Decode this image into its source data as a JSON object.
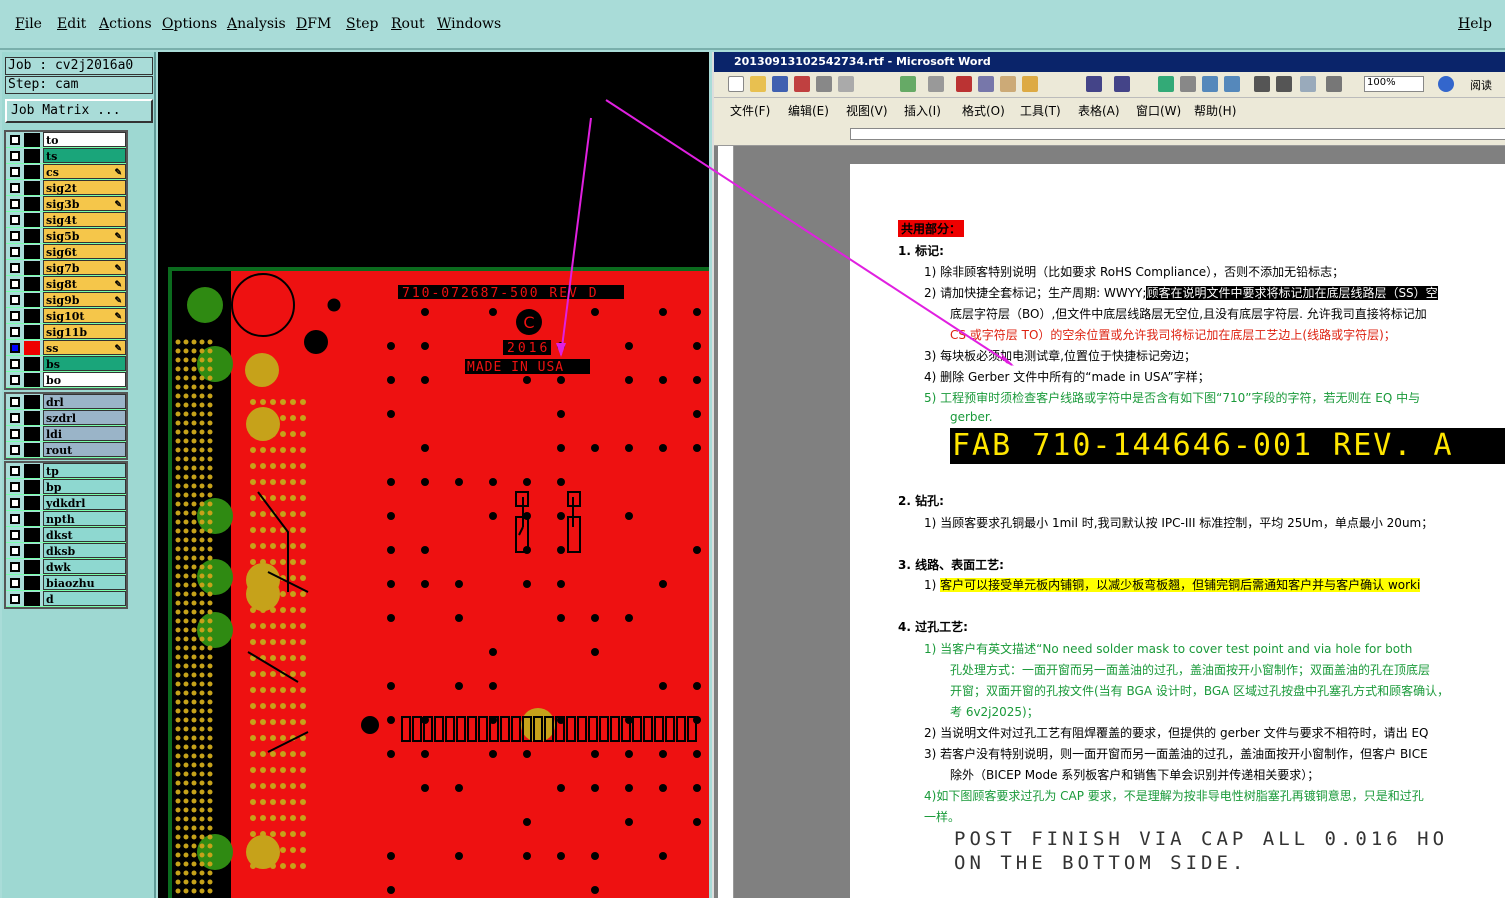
{
  "menu": {
    "file": "File",
    "edit": "Edit",
    "actions": "Actions",
    "options": "Options",
    "analysis": "Analysis",
    "dfm": "DFM",
    "step": "Step",
    "rout": "Rout",
    "windows": "Windows",
    "help": "Help"
  },
  "job": {
    "job_label": "Job : cv2j2016a0",
    "step_label": "Step: cam",
    "matrix_button": "Job Matrix ..."
  },
  "layers_a": [
    {
      "name": "to",
      "color": "#ffffff"
    },
    {
      "name": "ts",
      "color": "#1aa57a"
    },
    {
      "name": "cs",
      "color": "#f5c64a",
      "mark": "✎"
    },
    {
      "name": "sig2t",
      "color": "#f5c64a"
    },
    {
      "name": "sig3b",
      "color": "#f5c64a",
      "mark": "✎"
    },
    {
      "name": "sig4t",
      "color": "#f5c64a"
    },
    {
      "name": "sig5b",
      "color": "#f5c64a",
      "mark": "✎"
    },
    {
      "name": "sig6t",
      "color": "#f5c64a"
    },
    {
      "name": "sig7b",
      "color": "#f5c64a",
      "mark": "✎"
    },
    {
      "name": "sig8t",
      "color": "#f5c64a",
      "mark": "✎"
    },
    {
      "name": "sig9b",
      "color": "#f5c64a",
      "mark": "✎"
    },
    {
      "name": "sig10t",
      "color": "#f5c64a",
      "mark": "✎"
    },
    {
      "name": "sig11b",
      "color": "#f5c64a"
    },
    {
      "name": "ss",
      "color": "#f5c64a",
      "mark": "✎"
    },
    {
      "name": "bs",
      "color": "#1aa57a"
    },
    {
      "name": "bo",
      "color": "#ffffff"
    }
  ],
  "layers_b": [
    {
      "name": "drl"
    },
    {
      "name": "szdrl"
    },
    {
      "name": "ldi"
    },
    {
      "name": "rout"
    }
  ],
  "layers_c": [
    {
      "name": "tp"
    },
    {
      "name": "bp"
    },
    {
      "name": "ydkdrl"
    },
    {
      "name": "npth"
    },
    {
      "name": "dkst"
    },
    {
      "name": "dksb"
    },
    {
      "name": "dwk"
    },
    {
      "name": "biaozhu"
    },
    {
      "name": "d"
    }
  ],
  "pcb": {
    "text1": "710-072687-500 REV D",
    "text2": "2016",
    "text3": "MADE IN USA",
    "copyright": "C"
  },
  "word": {
    "title": "20130913102542734.rtf - Microsoft Word",
    "menu": [
      "文件(F)",
      "编辑(E)",
      "视图(V)",
      "插入(I)",
      "格式(O)",
      "工具(T)",
      "表格(A)",
      "窗口(W)",
      "帮助(H)"
    ],
    "zoom": "100%",
    "reading": "阅读",
    "heading": "共用部分：",
    "s1": "1.  标记:",
    "s1_1": "1)  除非顾客特别说明（比如要求 RoHS Compliance），否则不添加无铅标志；",
    "s1_2a": "2)  请加快捷全套标记；生产周期: WWYY;",
    "s1_2b": "顾客在说明文件中要求将标记加在底层线路层（SS）空",
    "s1_2c": "底层字符层（BO）,但文件中底层线路层无空位,且没有底层字符层. 允许我司直接将标记加",
    "s1_2d": "CS 或字符层 TO）的空余位置或允许我司将标记加在底层工艺边上(线路或字符层)；",
    "s1_3": "3)  每块板必须加电测试章,位置位于快捷标记旁边；",
    "s1_4": "4)  删除 Gerber 文件中所有的“made in USA”字样；",
    "s1_5a": "5)  工程预审时须检查客户线路或字符中是否含有如下图“710”字段的字符，若无则在 EQ 中与",
    "s1_5b": "gerber.",
    "fab": "FAB 710-144646-001 REV. A",
    "s2": "2.  钻孔:",
    "s2_1": "1)  当顾客要求孔铜最小 1mil 时,我司默认按 IPC-III 标准控制，平均 25Um，单点最小 20um；",
    "s3": "3.  线路、表面工艺:",
    "s3_1": "客户可以接受单元板内铺铜，以减少板弯板翘，但铺完铜后需通知客户并与客户确认 worki",
    "s4": "4.  过孔工艺:",
    "s4_1a": "1)  当客户有英文描述“No need solder mask to cover test point and via hole for both",
    "s4_1b": "孔处理方式：一面开窗而另一面盖油的过孔，盖油面按开小窗制作；双面盖油的孔在顶底层",
    "s4_1c": "开窗；双面开窗的孔按文件(当有 BGA 设计时，BGA 区域过孔按盘中孔塞孔方式和顾客确认，",
    "s4_1d": "考 6v2j2025)；",
    "s4_2": "2)  当说明文件对过孔工艺有阻焊覆盖的要求，但提供的 gerber 文件与要求不相符时，请出 EQ",
    "s4_3a": "3)  若客户没有特别说明，则一面开窗而另一面盖油的过孔，盖油面按开小窗制作，但客户 BICE",
    "s4_3b": "除外（BICEP Mode 系列板客户和销售下单会识别并传递相关要求）；",
    "s4_4a": "4)如下图顾客要求过孔为 CAP 要求，不是理解为按非导电性树脂塞孔再镀铜意思，只是和过孔",
    "s4_4b": "一样。",
    "post1": "POST FINISH VIA CAP ALL 0.016 HO",
    "post2": "ON THE BOTTOM SIDE."
  }
}
